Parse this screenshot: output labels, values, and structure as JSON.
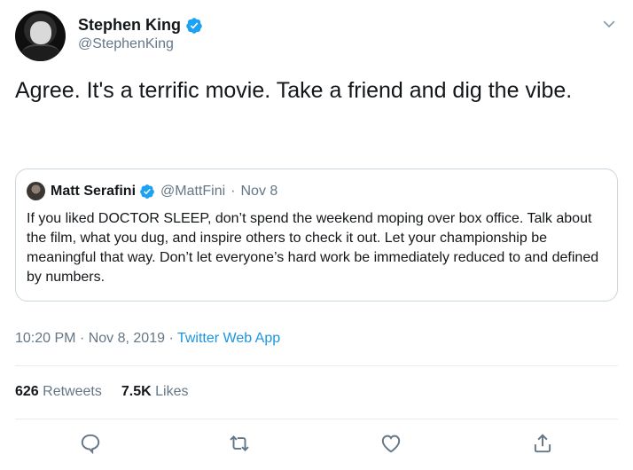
{
  "author": {
    "display_name": "Stephen King",
    "handle": "@StephenKing"
  },
  "tweet": {
    "text": "Agree. It's a terrific movie. Take a friend and dig the vibe.",
    "time": "10:20 PM",
    "date": "Nov 8, 2019",
    "source": "Twitter Web App"
  },
  "quoted": {
    "display_name": "Matt Serafini",
    "handle": "@MattFini",
    "date": "Nov 8",
    "text": "If you liked DOCTOR SLEEP, don’t spend the weekend moping over box office. Talk about the film, what you dug, and inspire others to check it out. Let your championship be meaningful that way. Don’t let everyone’s hard work be immediately reduced to and defined by numbers."
  },
  "stats": {
    "retweets_count": "626",
    "retweets_label": "Retweets",
    "likes_count": "7.5K",
    "likes_label": "Likes"
  },
  "icons": {
    "verified": "verified-badge-icon",
    "caret": "chevron-down-icon",
    "reply": "reply-icon",
    "retweet": "retweet-icon",
    "like": "heart-icon",
    "share": "share-icon"
  },
  "colors": {
    "accent": "#1da1f2",
    "link": "#1b95e0",
    "secondary_text": "#657786",
    "border": "#ccd6dd"
  }
}
